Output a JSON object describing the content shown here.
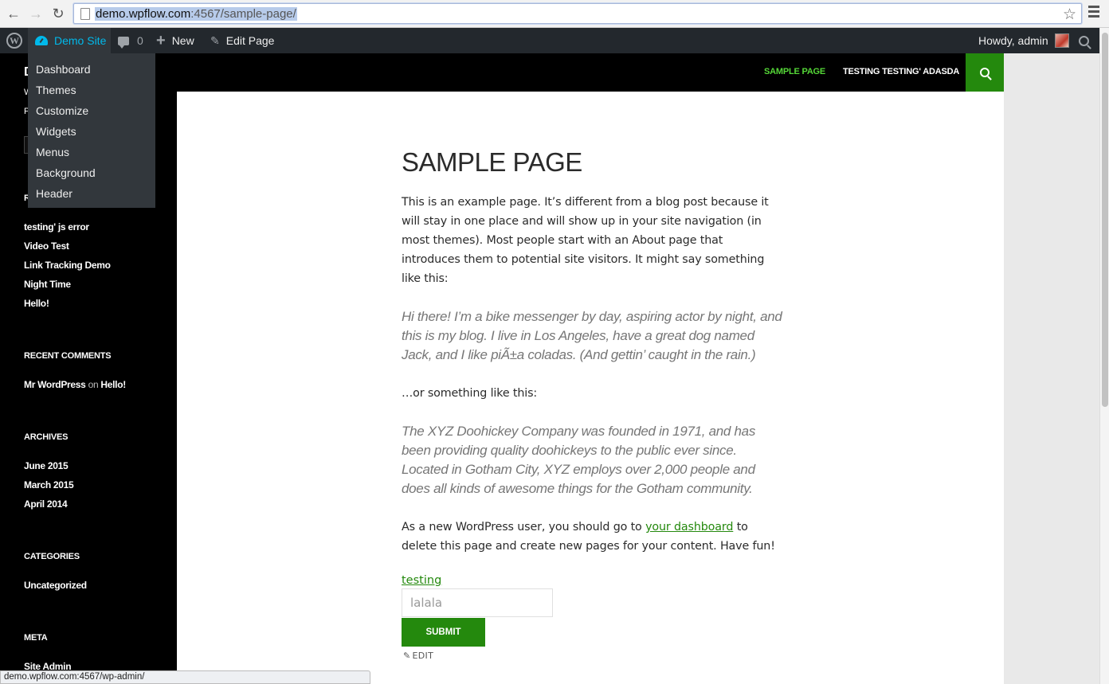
{
  "browser": {
    "url_host": "demo.wpflow.com",
    "url_path": ":4567/sample-page/",
    "status_url": "demo.wpflow.com:4567/wp-admin/"
  },
  "adminbar": {
    "site_name": "Demo Site",
    "comments_count": "0",
    "new_label": "New",
    "edit_page_label": "Edit Page",
    "greeting": "Howdy, admin"
  },
  "site_menu": [
    "Dashboard",
    "Themes",
    "Customize",
    "Widgets",
    "Menus",
    "Background",
    "Header"
  ],
  "topnav": {
    "items": [
      "SAMPLE PAGE",
      "TESTING TESTING' ADASDA"
    ],
    "active_color": "#55d737"
  },
  "sidebar": {
    "recent_posts": [
      "testing' js error",
      "Video Test",
      "Link Tracking Demo",
      "Night Time",
      "Hello!"
    ],
    "recent_comments_title": "RECENT COMMENTS",
    "comment": {
      "author": "Mr WordPress",
      "on": "on",
      "post": "Hello!"
    },
    "archives_title": "ARCHIVES",
    "archives": [
      "June 2015",
      "March 2015",
      "April 2014"
    ],
    "categories_title": "CATEGORIES",
    "categories": [
      "Uncategorized"
    ],
    "meta_title": "META",
    "meta_link": "Site Admin"
  },
  "page": {
    "title": "SAMPLE PAGE",
    "p1": "This is an example page. It’s different from a blog post because it will stay in one place and will show up in your site navigation (in most themes). Most people start with an About page that introduces them to potential site visitors. It might say something like this:",
    "quote1": "Hi there! I’m a bike messenger by day, aspiring actor by night, and this is my blog. I live in Los Angeles, have a great dog named Jack, and I like piÃ±a coladas. (And gettin’ caught in the rain.)",
    "p2": "…or something like this:",
    "quote2": "The XYZ Doohickey Company was founded in 1971, and has been providing quality doohickeys to the public ever since. Located in Gotham City, XYZ employs over 2,000 people and does all kinds of awesome things for the Gotham community.",
    "p3_before": "As a new WordPress user, you should go to ",
    "p3_link": "your dashboard",
    "p3_after": " to delete this page and create new pages for your content. Have fun!",
    "form_label": "testing",
    "input_value": "lalala",
    "submit_label": "SUBMIT",
    "edit_label": "EDIT"
  },
  "colors": {
    "accent_green": "#24890d",
    "admin_bar": "#23282d",
    "admin_blue": "#00b9eb"
  }
}
